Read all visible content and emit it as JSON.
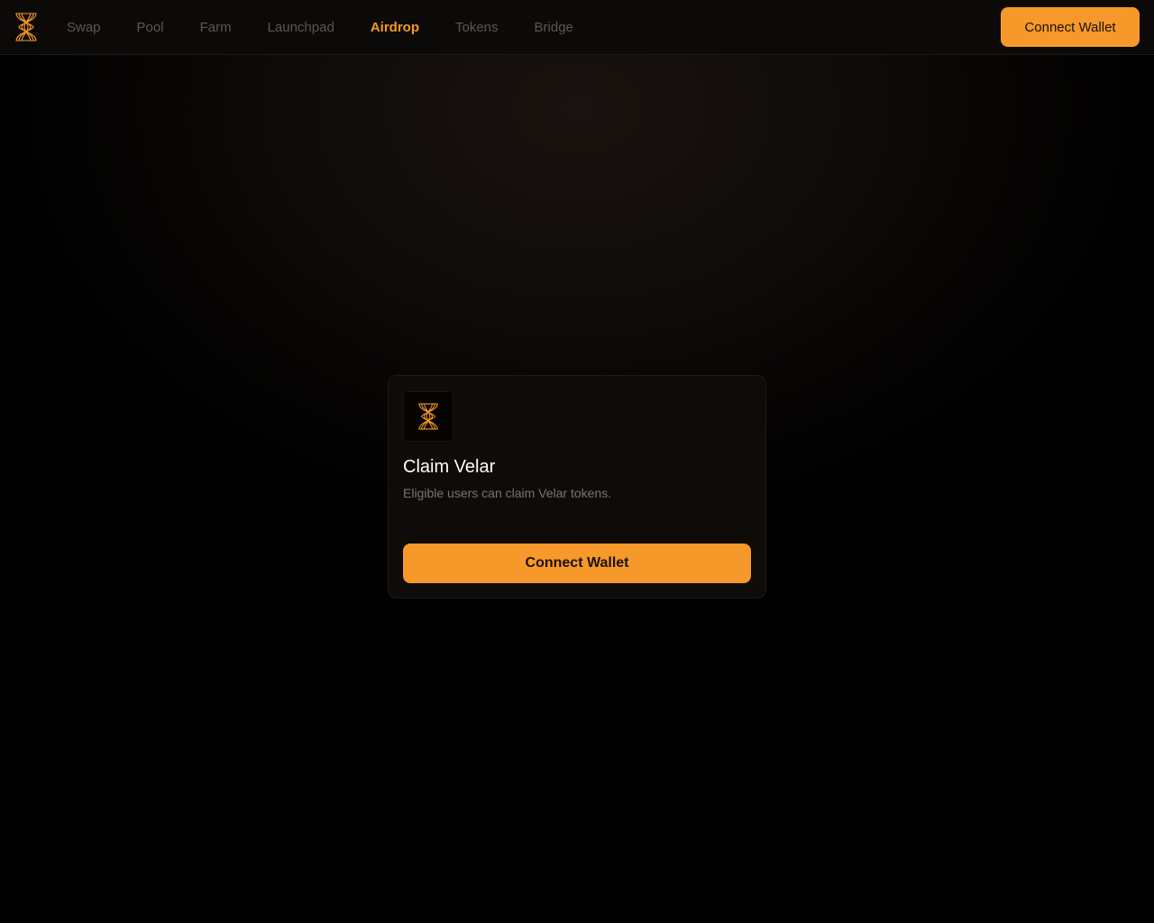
{
  "header": {
    "logo_icon": "velar-logo-icon",
    "nav": [
      {
        "label": "Swap",
        "active": false
      },
      {
        "label": "Pool",
        "active": false
      },
      {
        "label": "Farm",
        "active": false
      },
      {
        "label": "Launchpad",
        "active": false
      },
      {
        "label": "Airdrop",
        "active": true
      },
      {
        "label": "Tokens",
        "active": false
      },
      {
        "label": "Bridge",
        "active": false
      }
    ],
    "connect_label": "Connect Wallet"
  },
  "claim_card": {
    "logo_icon": "velar-logo-icon",
    "title": "Claim Velar",
    "description": "Eligible users can claim Velar tokens.",
    "connect_label": "Connect Wallet"
  },
  "colors": {
    "accent": "#f7982a",
    "background": "#000000",
    "nav_inactive": "#5c5652"
  }
}
